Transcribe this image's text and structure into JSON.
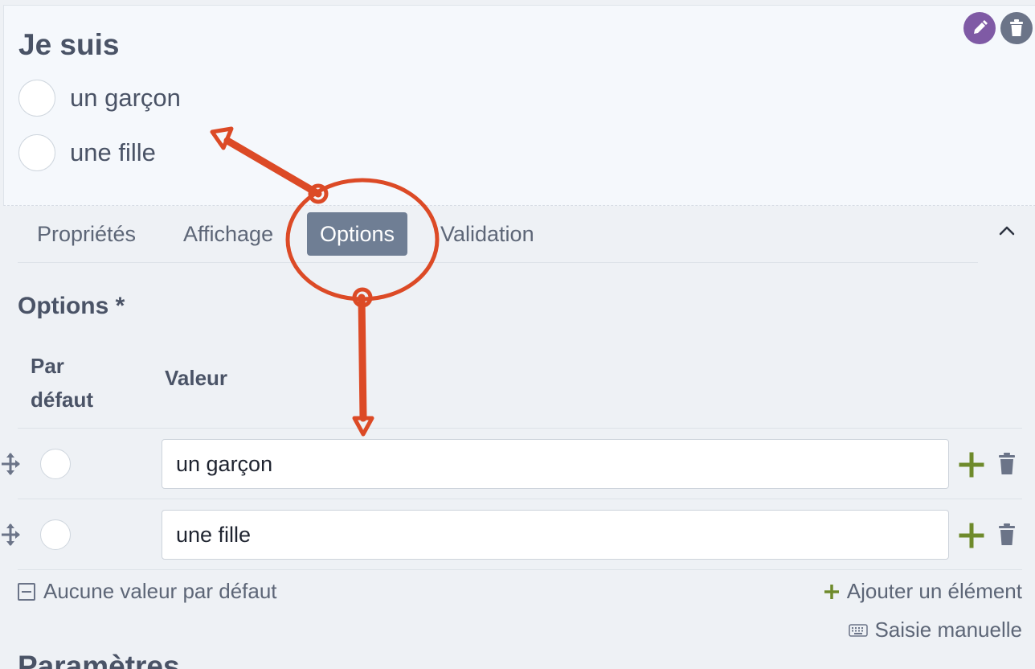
{
  "preview": {
    "question_title": "Je suis",
    "options": [
      "un garçon",
      "une fille"
    ]
  },
  "tabs": [
    {
      "label": "Propriétés",
      "active": false
    },
    {
      "label": "Affichage",
      "active": false
    },
    {
      "label": "Options",
      "active": true
    },
    {
      "label": "Validation",
      "active": false
    }
  ],
  "options_section": {
    "title": "Options *",
    "col_default": "Par défaut",
    "col_value": "Valeur",
    "rows": [
      {
        "value": "un garçon"
      },
      {
        "value": "une fille"
      }
    ],
    "no_default_label": "Aucune valeur par défaut",
    "add_element_label": "Ajouter un élément",
    "manual_entry_label": "Saisie manuelle"
  },
  "next_section_title": "Paramètres",
  "icons": {
    "edit": "pencil-icon",
    "delete": "trash-icon",
    "collapse": "chevron-up-icon",
    "drag": "drag-handle-icon",
    "add": "plus-icon",
    "keyboard": "keyboard-icon"
  },
  "colors": {
    "active_tab": "#6f7e94",
    "edit_button": "#7f5aa5",
    "delete_button": "#6b7488",
    "plus_icon": "#6e8a2b",
    "annotation": "#dc4a26"
  }
}
